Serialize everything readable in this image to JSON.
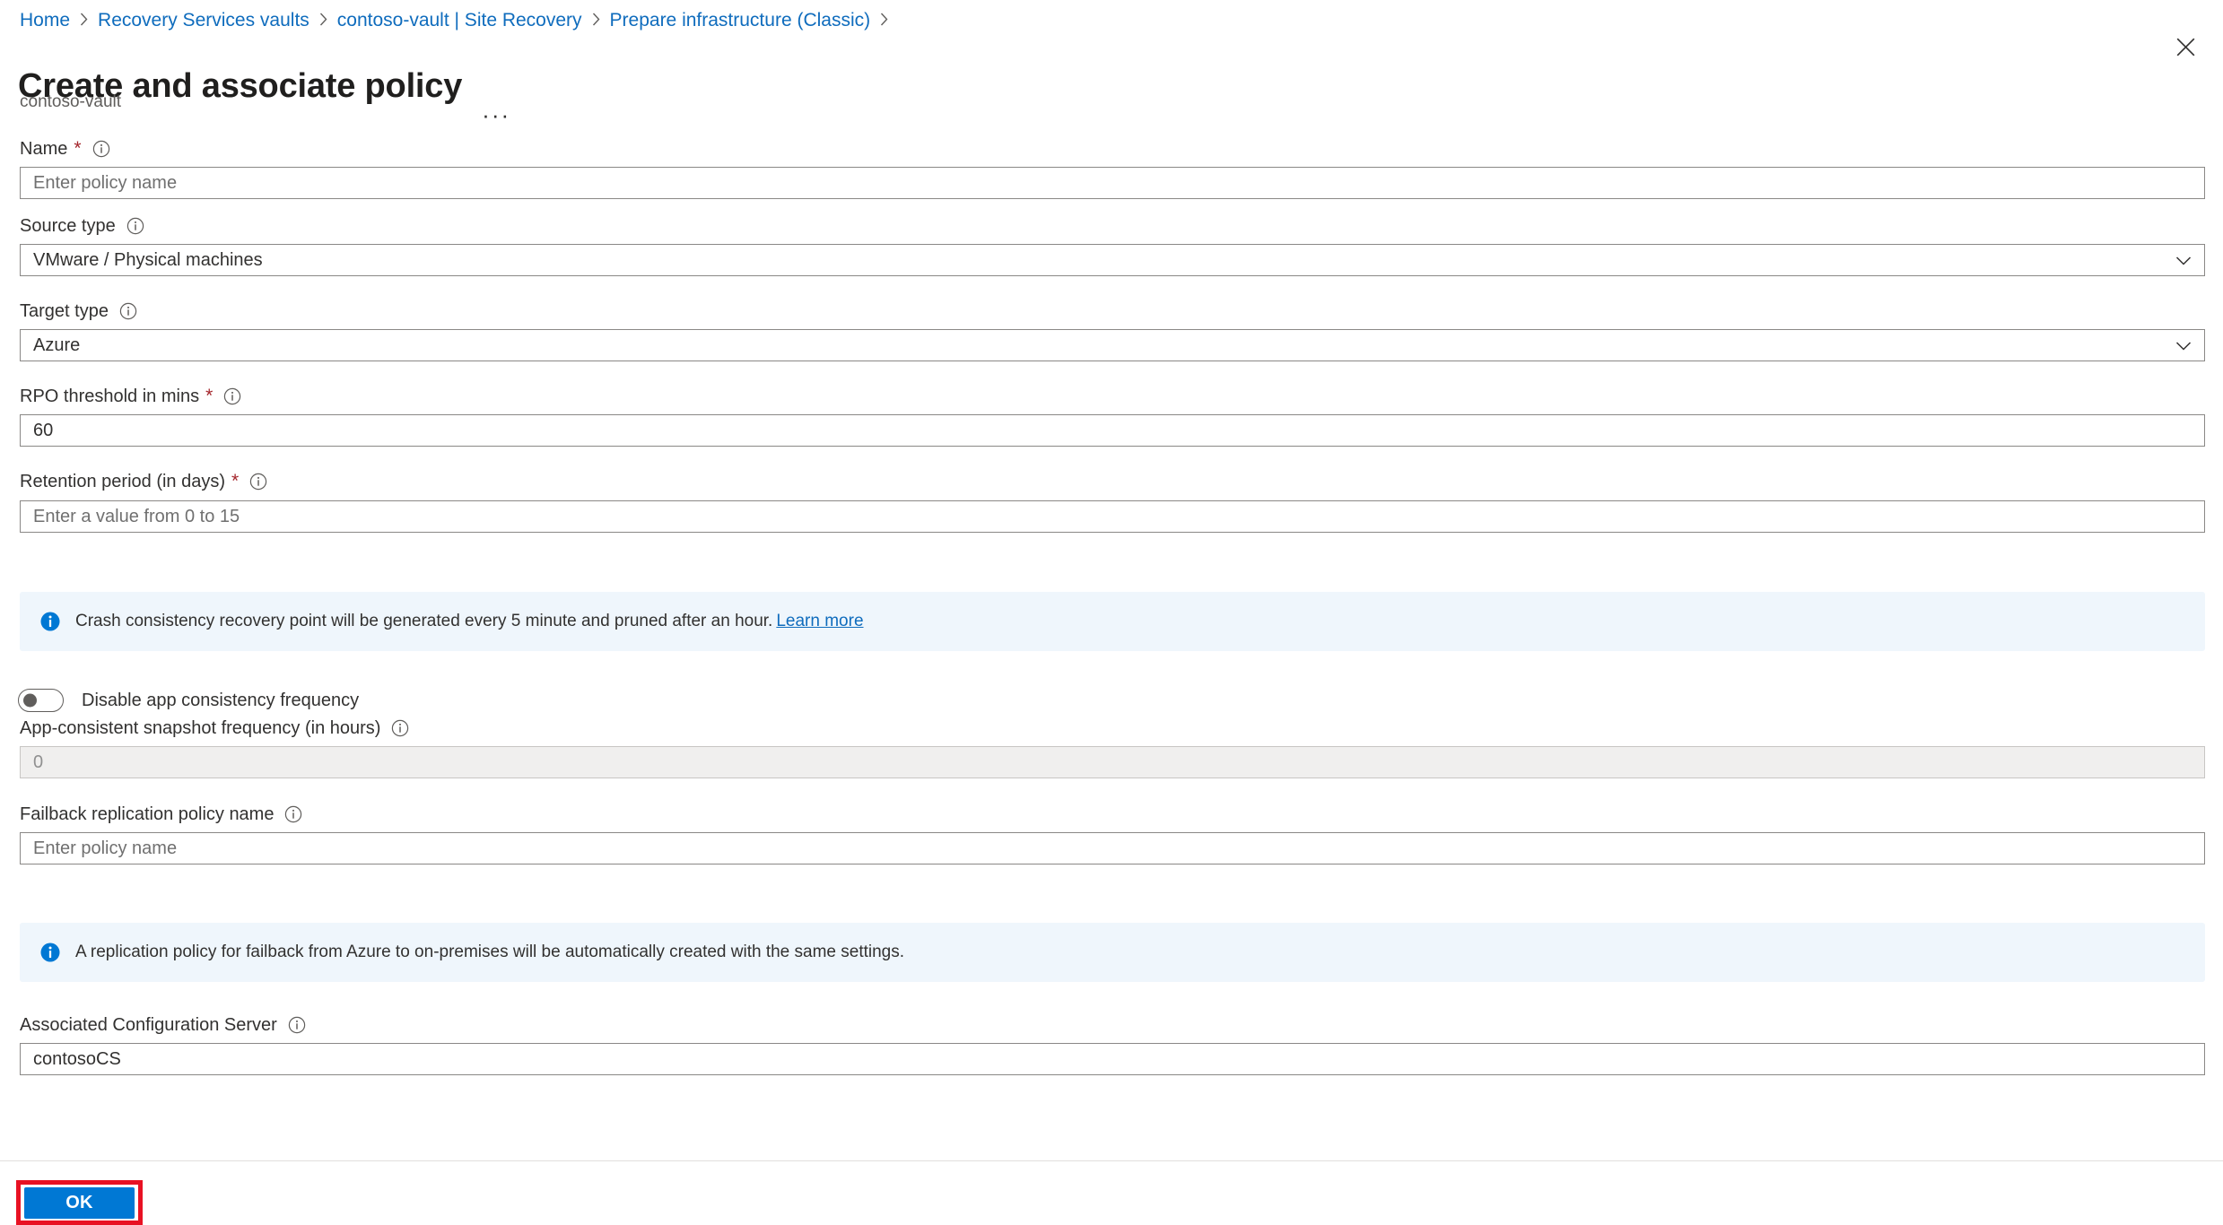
{
  "breadcrumb": {
    "items": [
      {
        "label": "Home"
      },
      {
        "label": "Recovery Services vaults"
      },
      {
        "label": "contoso-vault | Site Recovery"
      },
      {
        "label": "Prepare infrastructure (Classic)"
      }
    ],
    "separator": ">"
  },
  "header": {
    "title": "Create and associate policy",
    "subtitle": "contoso-vault",
    "more_menu": "···",
    "close_icon": "close-icon"
  },
  "form": {
    "name": {
      "label": "Name",
      "required_marker": "*",
      "info_icon": "info-icon",
      "value": "",
      "placeholder": "Enter policy name"
    },
    "source_type": {
      "label": "Source type",
      "info_icon": "info-icon",
      "value": "VMware / Physical machines",
      "options": [
        "VMware / Physical machines"
      ],
      "chevron_icon": "chevron-down-icon"
    },
    "target_type": {
      "label": "Target type",
      "info_icon": "info-icon",
      "value": "Azure",
      "options": [
        "Azure"
      ],
      "chevron_icon": "chevron-down-icon"
    },
    "rpo_threshold": {
      "label": "RPO threshold in mins",
      "required_marker": "*",
      "info_icon": "info-icon",
      "value": "60"
    },
    "retention_period": {
      "label": "Retention period (in days)",
      "required_marker": "*",
      "info_icon": "info-icon",
      "value": "",
      "placeholder": "Enter a value from 0 to 15"
    },
    "crash_consistency_banner": {
      "icon": "info-filled-icon",
      "text": "Crash consistency recovery point will be generated every 5 minute and pruned after an hour.",
      "link_text": "Learn more"
    },
    "disable_app_consistency": {
      "label": "Disable app consistency frequency",
      "state": "off"
    },
    "app_consistent_frequency": {
      "label": "App-consistent snapshot frequency (in hours)",
      "info_icon": "info-icon",
      "value": "0",
      "disabled": true
    },
    "failback_policy_name": {
      "label": "Failback replication policy name",
      "info_icon": "info-icon",
      "value": "",
      "placeholder": "Enter policy name"
    },
    "failback_banner": {
      "icon": "info-filled-icon",
      "text": "A replication policy for failback from Azure to on-premises will be automatically created with the same settings."
    },
    "associated_configuration_server": {
      "label": "Associated Configuration Server",
      "info_icon": "info-icon",
      "value": "contosoCS"
    }
  },
  "footer": {
    "ok_label": "OK"
  },
  "colors": {
    "accent": "#0078d4",
    "link": "#0f6cbd",
    "required": "#a4262c",
    "banner_bg": "#eff6fc",
    "highlight": "#e81123"
  }
}
